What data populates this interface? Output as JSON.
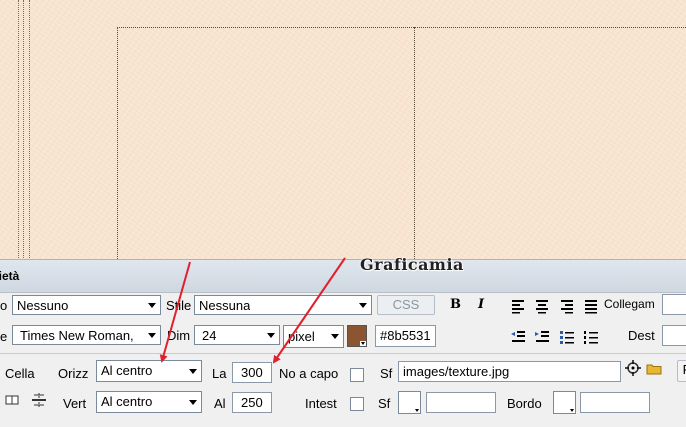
{
  "panel": {
    "title": "rietà",
    "watermark": "Graficamia"
  },
  "text_row": {
    "format_label_partial": "o",
    "format_value": "Nessuno",
    "style_label": "Stile",
    "style_value": "Nessuna",
    "css_label": "CSS",
    "bold_label": "B",
    "italic_label": "I",
    "link_label": "Collegam",
    "font_label_partial": "e",
    "font_value": "Times New Roman,",
    "size_label": "Dim",
    "size_value": "24",
    "unit_value": "pixel",
    "color_value": "#8b5531",
    "color_hex": "#8b5531",
    "target_label": "Dest"
  },
  "cell_row": {
    "cell_label": "Cella",
    "horz_label": "Orizz",
    "horz_value": "Al centro",
    "width_label": "La",
    "width_value": "300",
    "nowrap_label": "No a capo",
    "bg_label": "Sf",
    "bg_value": "images/texture.jpg",
    "vert_label": "Vert",
    "vert_value": "Al centro",
    "height_label": "Al",
    "height_value": "250",
    "header_label": "Intest",
    "bgcolor_label": "Sf",
    "border_label": "Bordo",
    "page_label_partial": "P"
  },
  "colors": {
    "canvas_bg": "#f9e6d3",
    "arrow": "#e0202a",
    "panel_bg": "#f0f0f0"
  }
}
